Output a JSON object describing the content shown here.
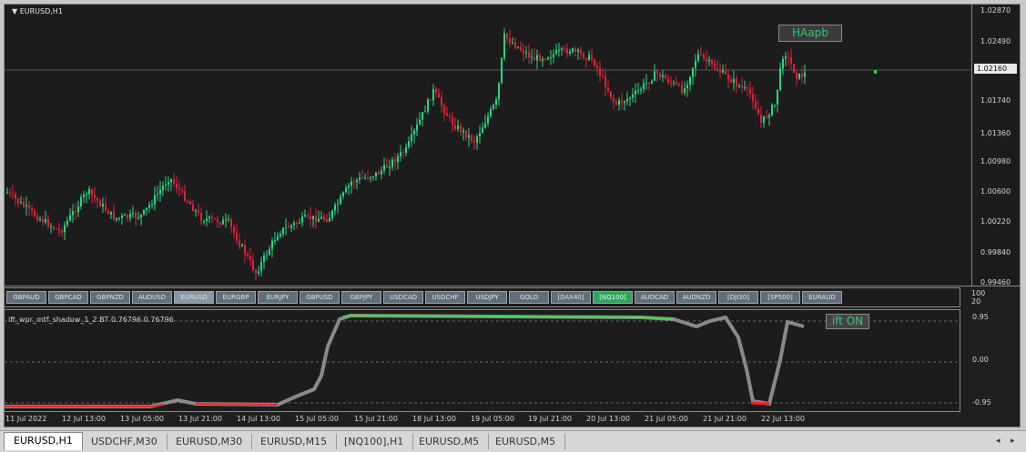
{
  "main_chart": {
    "title": "EURUSD,H1",
    "current_price": "1.02160",
    "price_labels": [
      "1.02870",
      "1.02490",
      "1.02160",
      "1.01740",
      "1.01360",
      "1.00980",
      "1.00600",
      "1.00220",
      "0.99840",
      "0.99460"
    ],
    "haapb_label": "HAapb",
    "menu_arrow": "▼"
  },
  "symbol_buttons": [
    {
      "label": "GBPAUD"
    },
    {
      "label": "GBPCAD"
    },
    {
      "label": "GBPNZD"
    },
    {
      "label": "AUDUSD"
    },
    {
      "label": "EURUSD",
      "state": "active"
    },
    {
      "label": "EURGBP"
    },
    {
      "label": "EURJPY"
    },
    {
      "label": "GBPUSD"
    },
    {
      "label": "GBPJPY"
    },
    {
      "label": "USDCAD"
    },
    {
      "label": "USDCHF"
    },
    {
      "label": "USDJPY"
    },
    {
      "label": "GOLD"
    },
    {
      "label": "[DAX40]"
    },
    {
      "label": "[NQ100]",
      "state": "green"
    },
    {
      "label": "AUDCAD"
    },
    {
      "label": "AUDNZD"
    },
    {
      "label": "[DJI30]"
    },
    {
      "label": "[SP500]"
    },
    {
      "label": "EURAUD"
    }
  ],
  "button_pane_scale": [
    "100",
    "20"
  ],
  "indicator": {
    "title": "ift_wpr_mtf_shadow_1_2 BT 0.76796 0.76796",
    "toggle_label": "ift ON",
    "scale": [
      "0.95",
      "0.00",
      "-0.95"
    ],
    "colors": {
      "shadow": "#8a8a8a",
      "up": "#3ddc4a",
      "down": "#ff2020"
    }
  },
  "time_labels": [
    "11 Jul 2022",
    "12 Jul 13:00",
    "13 Jul 05:00",
    "13 Jul 21:00",
    "14 Jul 13:00",
    "15 Jul 05:00",
    "15 Jul 21:00",
    "18 Jul 13:00",
    "19 Jul 05:00",
    "19 Jul 21:00",
    "20 Jul 13:00",
    "21 Jul 05:00",
    "21 Jul 21:00",
    "22 Jul 13:00"
  ],
  "tabs": [
    {
      "label": "EURUSD,H1",
      "active": true
    },
    {
      "label": "USDCHF,M30"
    },
    {
      "label": "EURUSD,M30"
    },
    {
      "label": "EURUSD,M15"
    },
    {
      "label": "[NQ100],H1"
    },
    {
      "label": "EURUSD,M5"
    },
    {
      "label": "EURUSD,M5"
    }
  ],
  "tab_scroll": {
    "left": "◂",
    "right": "▸"
  },
  "colors": {
    "bull": "#26d87f",
    "bear": "#e0213a",
    "grid": "#3a3a3a"
  }
}
